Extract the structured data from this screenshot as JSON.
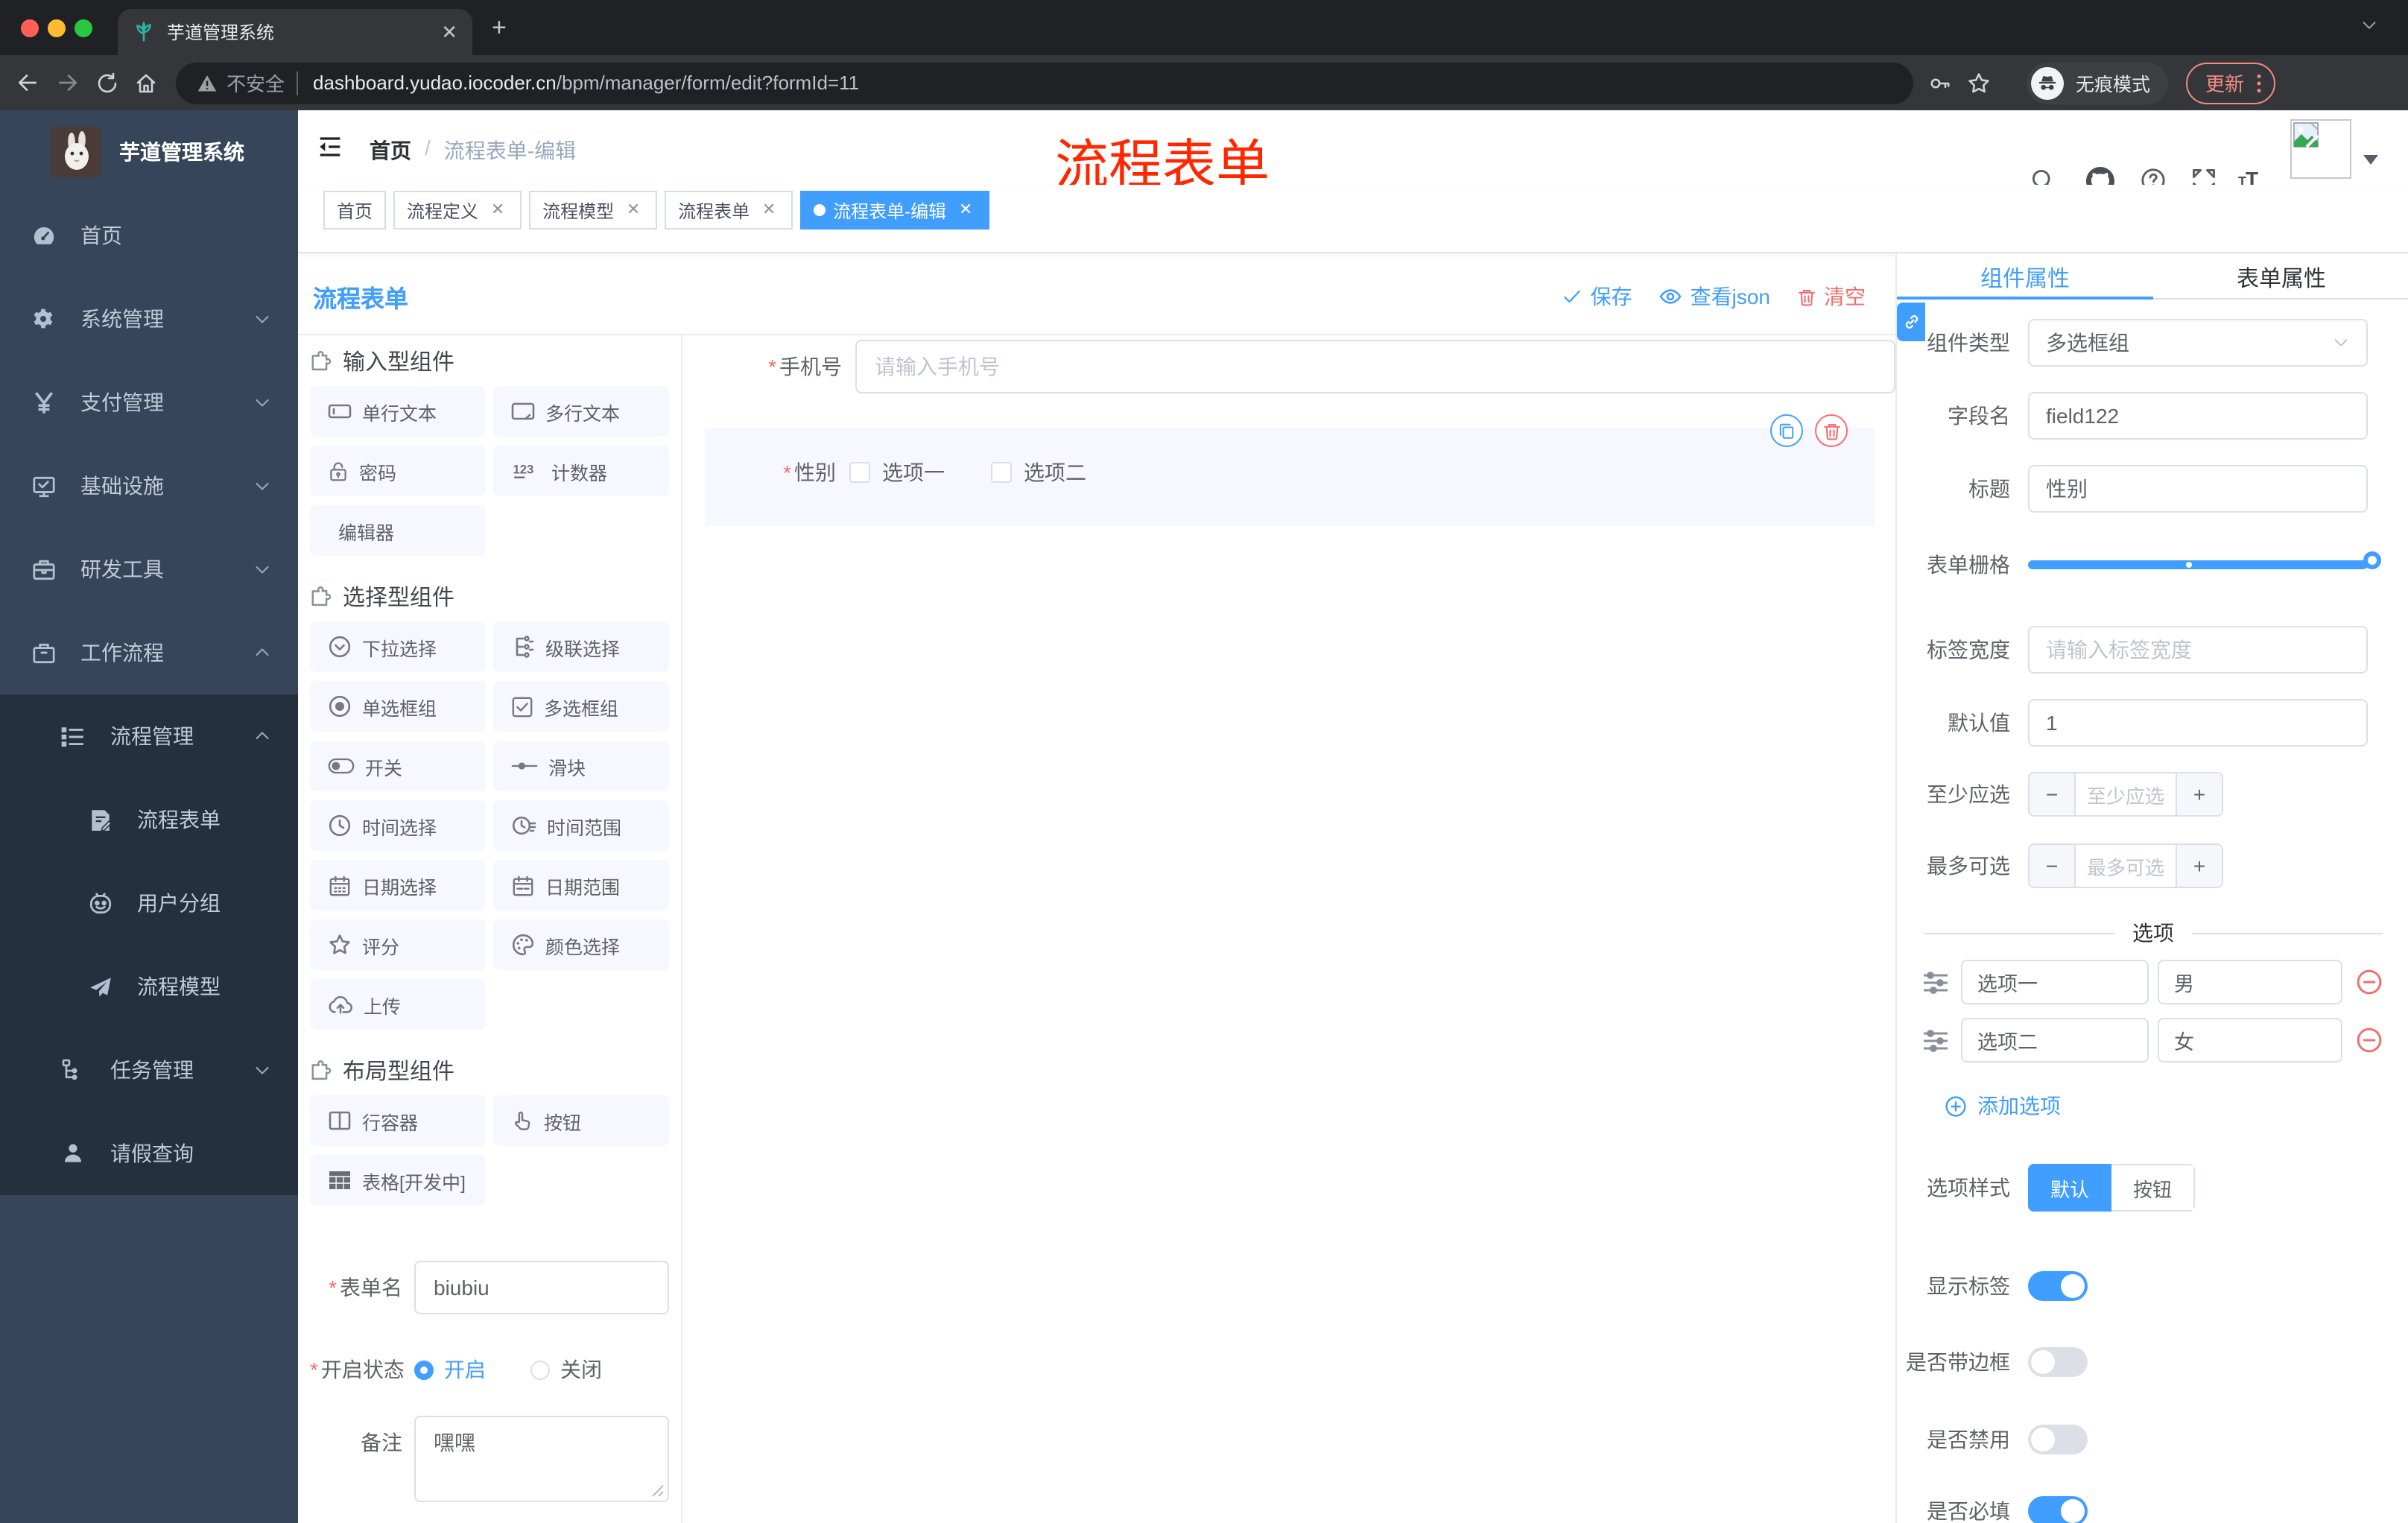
{
  "browser": {
    "tab_title": "芋道管理系统",
    "close_glyph": "✕",
    "new_tab_glyph": "+",
    "security_label": "不安全",
    "url_host": "dashboard.yudao.iocoder.cn",
    "url_path": "/bpm/manager/form/edit?formId=11",
    "incognito_label": "无痕模式",
    "update_label": "更新"
  },
  "sidebar": {
    "logo_title": "芋道管理系统",
    "items": [
      {
        "icon": "dashboard",
        "label": "首页",
        "level": 1
      },
      {
        "icon": "gear",
        "label": "系统管理",
        "level": 1,
        "chevron": "down"
      },
      {
        "icon": "yen",
        "label": "支付管理",
        "level": 1,
        "chevron": "down"
      },
      {
        "icon": "monitor",
        "label": "基础设施",
        "level": 1,
        "chevron": "down"
      },
      {
        "icon": "toolbox",
        "label": "研发工具",
        "level": 1,
        "chevron": "down"
      },
      {
        "icon": "suitcase",
        "label": "工作流程",
        "level": 1,
        "chevron": "up"
      },
      {
        "icon": "listops",
        "label": "流程管理",
        "level": 2,
        "chevron": "up",
        "dark": true
      },
      {
        "icon": "formdoc",
        "label": "流程表单",
        "level": 3,
        "dark": true
      },
      {
        "icon": "face",
        "label": "用户分组",
        "level": 3,
        "dark": true
      },
      {
        "icon": "plane",
        "label": "流程模型",
        "level": 3,
        "dark": true
      },
      {
        "icon": "tree",
        "label": "任务管理",
        "level": 2,
        "chevron": "down",
        "dark": true
      },
      {
        "icon": "person",
        "label": "请假查询",
        "level": 2,
        "dark": true
      }
    ]
  },
  "navbar": {
    "breadcrumb_home": "首页",
    "breadcrumb_sep": "/",
    "breadcrumb_current": "流程表单-编辑",
    "annotation": "流程表单"
  },
  "tags": [
    {
      "label": "首页",
      "closable": false,
      "active": false
    },
    {
      "label": "流程定义",
      "closable": true,
      "active": false
    },
    {
      "label": "流程模型",
      "closable": true,
      "active": false
    },
    {
      "label": "流程表单",
      "closable": true,
      "active": false
    },
    {
      "label": "流程表单-编辑",
      "closable": true,
      "active": true
    }
  ],
  "designer_header": {
    "title": "流程表单",
    "save_label": "保存",
    "view_json_label": "查看json",
    "clear_label": "清空"
  },
  "components_panel": {
    "sections": [
      {
        "title": "输入型组件",
        "items": [
          {
            "icon": "inputbox",
            "label": "单行文本"
          },
          {
            "icon": "textarea",
            "label": "多行文本"
          },
          {
            "icon": "lock",
            "label": "密码"
          },
          {
            "icon": "counter",
            "label": "计数器"
          },
          {
            "icon": "none",
            "label": "编辑器"
          }
        ]
      },
      {
        "title": "选择型组件",
        "items": [
          {
            "icon": "selectcir",
            "label": "下拉选择"
          },
          {
            "icon": "cascade",
            "label": "级联选择"
          },
          {
            "icon": "radiogrp",
            "label": "单选框组"
          },
          {
            "icon": "checkgrp",
            "label": "多选框组"
          },
          {
            "icon": "switch",
            "label": "开关"
          },
          {
            "icon": "sliderct",
            "label": "滑块"
          },
          {
            "icon": "clock",
            "label": "时间选择"
          },
          {
            "icon": "clockrange",
            "label": "时间范围"
          },
          {
            "icon": "calendar",
            "label": "日期选择"
          },
          {
            "icon": "calrange",
            "label": "日期范围"
          },
          {
            "icon": "staro",
            "label": "评分"
          },
          {
            "icon": "palette",
            "label": "颜色选择"
          },
          {
            "icon": "upload",
            "label": "上传"
          }
        ]
      },
      {
        "title": "布局型组件",
        "items": [
          {
            "icon": "rowcol",
            "label": "行容器"
          },
          {
            "icon": "hand",
            "label": "按钮"
          },
          {
            "icon": "tablegrid",
            "label": "表格[开发中]"
          }
        ]
      }
    ],
    "form": {
      "name_label": "表单名",
      "name_value": "biubiu",
      "status_label": "开启状态",
      "status_on": "开启",
      "status_off": "关闭",
      "remark_label": "备注",
      "remark_value": "嘿嘿"
    }
  },
  "canvas": {
    "phone": {
      "label": "手机号",
      "placeholder": "请输入手机号"
    },
    "gender": {
      "label": "性别",
      "options": [
        "选项一",
        "选项二"
      ]
    }
  },
  "props": {
    "tab_component": "组件属性",
    "tab_form": "表单属性",
    "component_type_label": "组件类型",
    "component_type_value": "多选框组",
    "field_name_label": "字段名",
    "field_name_value": "field122",
    "title_label": "标题",
    "title_value": "性别",
    "grid_label": "表单栅格",
    "label_width_label": "标签宽度",
    "label_width_placeholder": "请输入标签宽度",
    "default_label": "默认值",
    "default_value": "1",
    "min_label": "至少应选",
    "min_placeholder": "至少应选",
    "max_label": "最多可选",
    "max_placeholder": "最多可选",
    "options_divider": "选项",
    "option_rows": [
      {
        "label": "选项一",
        "value": "男"
      },
      {
        "label": "选项二",
        "value": "女"
      }
    ],
    "add_option_label": "添加选项",
    "option_style_label": "选项样式",
    "option_style_choices": [
      "默认",
      "按钮"
    ],
    "option_style_active": "默认",
    "switches": [
      {
        "label": "显示标签",
        "on": true
      },
      {
        "label": "是否带边框",
        "on": false
      },
      {
        "label": "是否禁用",
        "on": false
      },
      {
        "label": "是否必填",
        "on": true
      }
    ]
  },
  "colors": {
    "accent": "#409eff",
    "danger": "#f56c6c",
    "sidebar_bg": "#36455a",
    "sidebar_sub_bg": "#25303f",
    "annotation_red": "#ff2600"
  }
}
